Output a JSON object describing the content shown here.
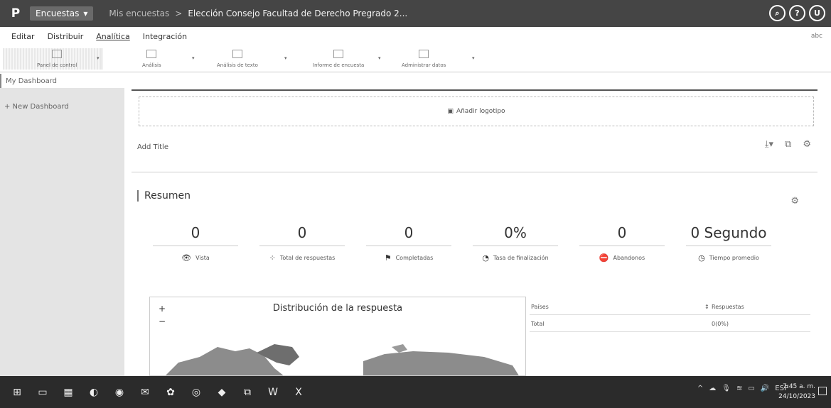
{
  "header": {
    "app_menu": "Encuestas",
    "breadcrumb_root": "Mis encuestas",
    "breadcrumb_sep": ">",
    "survey_title": "Elección Consejo Facultad de Derecho Pregrado 2..."
  },
  "tabs": [
    {
      "label": "Editar"
    },
    {
      "label": "Distribuir"
    },
    {
      "label": "Analítica"
    },
    {
      "label": "Integración"
    }
  ],
  "toolbar": {
    "items": [
      "Panel de control",
      "Análisis",
      "Análisis de texto",
      "Informe de encuesta",
      "Administrar datos"
    ],
    "right_text": "abc"
  },
  "sidebar": {
    "items": [
      {
        "label": "My Dashboard"
      },
      {
        "label": "+ New Dashboard"
      }
    ]
  },
  "main": {
    "add_logo": "Añadir logotipo",
    "add_title": "Add Title",
    "section_title": "Resumen",
    "stats": [
      {
        "value": "0",
        "label": "Vista",
        "icon": "eye-icon"
      },
      {
        "value": "0",
        "label": "Total de respuestas",
        "icon": "grid-icon"
      },
      {
        "value": "0",
        "label": "Completadas",
        "icon": "flag-icon"
      },
      {
        "value": "0%",
        "label": "Tasa de finalización",
        "icon": "gauge-icon"
      },
      {
        "value": "0",
        "label": "Abandonos",
        "icon": "stop-icon"
      },
      {
        "value": "0 Segundo",
        "label": "Tiempo promedio",
        "icon": "clock-icon"
      }
    ],
    "map_title": "Distribución de la respuesta",
    "table": {
      "col_country": "Países",
      "col_responses": "Respuestas",
      "total_label": "Total",
      "total_value": "0(0%)"
    }
  },
  "taskbar": {
    "tray_lang": "ESP",
    "time": "7:45 a. m.",
    "date": "24/10/2023"
  }
}
